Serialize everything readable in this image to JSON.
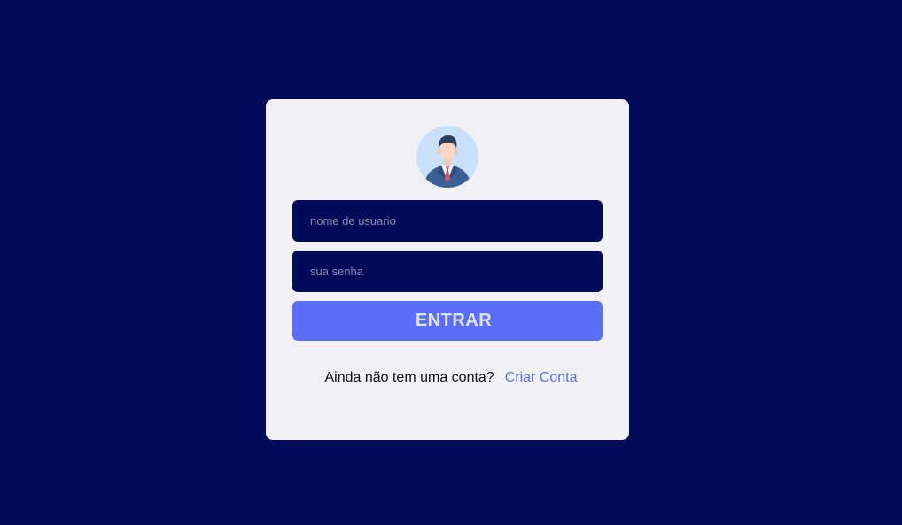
{
  "login": {
    "avatar_icon": "user-avatar-icon",
    "username": {
      "placeholder": "nome de usuario",
      "value": ""
    },
    "password": {
      "placeholder": "sua senha",
      "value": ""
    },
    "submit_label": "ENTRAR",
    "signup_prompt": "Ainda não tem uma conta?",
    "signup_link": "Criar Conta"
  },
  "colors": {
    "background": "#020a5a",
    "card": "#f1f1f5",
    "input_bg": "#020a5a",
    "accent": "#5b6ef7"
  }
}
